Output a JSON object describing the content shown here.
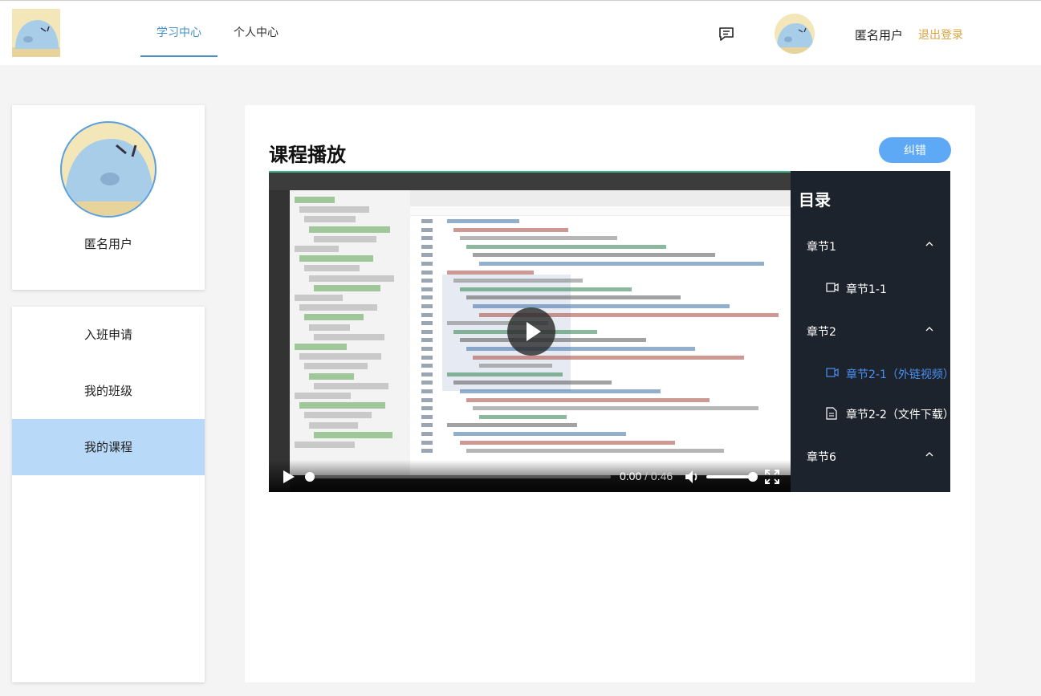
{
  "header": {
    "nav": [
      "学习中心",
      "个人中心"
    ],
    "active_nav": "学习中心",
    "username": "匿名用户",
    "logout": "退出登录",
    "message_icon": "message-icon"
  },
  "sidebar": {
    "profile_name": "匿名用户",
    "menu": [
      "入班申请",
      "我的班级",
      "我的课程"
    ],
    "active_menu": "我的课程"
  },
  "main": {
    "title": "课程播放",
    "report_button": "纠错"
  },
  "video": {
    "current_time": "0:00",
    "separator": " / ",
    "duration": "0:46",
    "progress": 0,
    "volume": 1.0
  },
  "catalog": {
    "title": "目录",
    "chapters": [
      {
        "label": "章节1",
        "sections": [
          {
            "label": "章节1-1",
            "icon": "video-icon"
          }
        ]
      },
      {
        "label": "章节2",
        "sections": [
          {
            "label": "章节2-1（外链视频）",
            "icon": "video-icon",
            "active": true
          },
          {
            "label": "章节2-2（文件下载）",
            "icon": "file-icon"
          }
        ]
      },
      {
        "label": "章节6",
        "sections": []
      }
    ]
  },
  "colors": {
    "accent": "#4a90c8",
    "logout": "#d9a441",
    "active_menu_bg": "#b8d9f8",
    "button_bg": "#5ea9f5",
    "catalog_bg": "#1c232d",
    "catalog_active": "#4a8ff0"
  }
}
